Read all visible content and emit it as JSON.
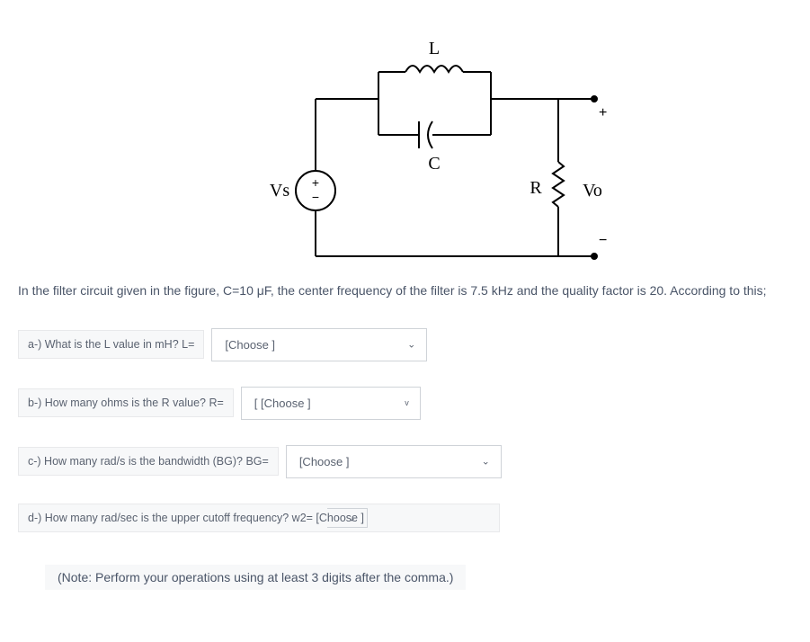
{
  "circuit": {
    "L_label": "L",
    "C_label": "C",
    "R_label": "R",
    "Vs_label": "Vs",
    "Vo_label": "Vo",
    "plus": "+",
    "minus": "−"
  },
  "problem_text": "In the filter circuit given in the figure, C=10 μF, the center frequency of the filter is 7.5 kHz and the quality factor is 20. According to this;",
  "questions": {
    "a": {
      "label": "a-) What is the L value in mH? L=",
      "placeholder": "[Choose ]"
    },
    "b": {
      "label": "b-) How many ohms is the R value? R=",
      "placeholder": "[ [Choose ]"
    },
    "c": {
      "label": "c-) How many rad/s is the bandwidth (BG)? BG=",
      "placeholder": "[Choose ]"
    },
    "d": {
      "label": "d-) How many rad/sec is the upper cutoff frequency? w2= [Choose ]",
      "placeholder": ""
    }
  },
  "note": "(Note: Perform your operations using at least 3 digits after the comma.)"
}
